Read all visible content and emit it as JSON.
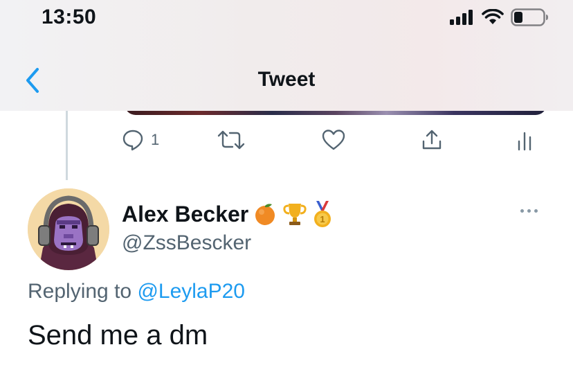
{
  "status_bar": {
    "time": "13:50",
    "icons": [
      "signal-icon",
      "wifi-icon",
      "battery-icon"
    ]
  },
  "nav": {
    "title": "Tweet",
    "back_icon": "chevron-left-icon"
  },
  "parent_tweet_actions": {
    "reply_count": "1",
    "icons": [
      "reply-icon",
      "retweet-icon",
      "like-icon",
      "share-icon",
      "analytics-icon"
    ]
  },
  "reply_tweet": {
    "author_name": "Alex Becker",
    "badges": [
      "orange-emoji",
      "trophy-emoji",
      "medal-emoji"
    ],
    "handle": "@ZssBescker",
    "replying_to_label": "Replying to",
    "replying_to_handle": "@LeylaP20",
    "text": "Send me a dm"
  },
  "colors": {
    "link": "#1d9bf0",
    "secondary_text": "#536471",
    "primary_text": "#0f1419",
    "thread_line": "#cfd9de"
  }
}
